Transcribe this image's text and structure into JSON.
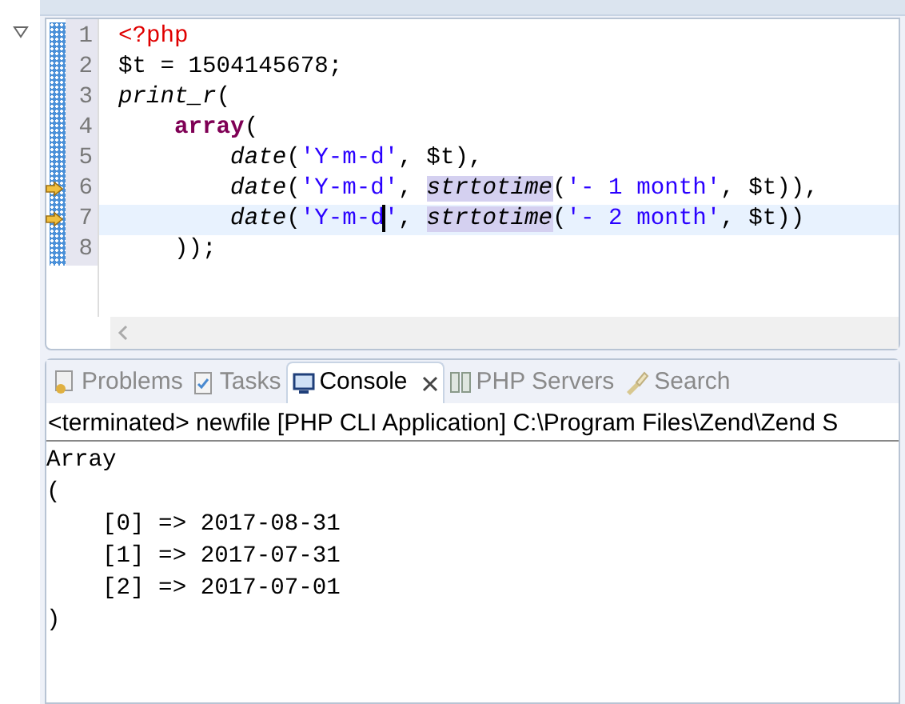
{
  "editor": {
    "lines": [
      {
        "number": "1",
        "current": false,
        "marker": false,
        "tokens": [
          {
            "kind": "tag",
            "text": "<?php"
          }
        ]
      },
      {
        "number": "2",
        "current": false,
        "marker": false,
        "tokens": [
          {
            "kind": "plain",
            "text": "$t = 1504145678;"
          }
        ]
      },
      {
        "number": "3",
        "current": false,
        "marker": false,
        "tokens": [
          {
            "kind": "func",
            "text": "print_r"
          },
          {
            "kind": "plain",
            "text": "("
          }
        ]
      },
      {
        "number": "4",
        "current": false,
        "marker": false,
        "tokens": [
          {
            "kind": "keyword",
            "text": "    array"
          },
          {
            "kind": "plain",
            "text": "("
          }
        ]
      },
      {
        "number": "5",
        "current": false,
        "marker": false,
        "tokens": [
          {
            "kind": "func",
            "text": "        date"
          },
          {
            "kind": "plain",
            "text": "("
          },
          {
            "kind": "string",
            "text": "'Y-m-d'"
          },
          {
            "kind": "plain",
            "text": ", $t),"
          }
        ]
      },
      {
        "number": "6",
        "current": false,
        "marker": true,
        "tokens": [
          {
            "kind": "func",
            "text": "        date"
          },
          {
            "kind": "plain",
            "text": "("
          },
          {
            "kind": "string",
            "text": "'Y-m-d'"
          },
          {
            "kind": "plain",
            "text": ", "
          },
          {
            "kind": "hfunc",
            "text": "strtotime"
          },
          {
            "kind": "plain",
            "text": "("
          },
          {
            "kind": "string",
            "text": "'- 1 month'"
          },
          {
            "kind": "plain",
            "text": ", $t)),"
          }
        ]
      },
      {
        "number": "7",
        "current": true,
        "marker": true,
        "tokens": [
          {
            "kind": "func",
            "text": "        date"
          },
          {
            "kind": "plain",
            "text": "("
          },
          {
            "kind": "string",
            "text": "'Y-m-d"
          },
          {
            "kind": "caret"
          },
          {
            "kind": "string",
            "text": "'"
          },
          {
            "kind": "plain",
            "text": ", "
          },
          {
            "kind": "hfunc",
            "text": "strtotime"
          },
          {
            "kind": "plain",
            "text": "("
          },
          {
            "kind": "string",
            "text": "'- 2 month'"
          },
          {
            "kind": "plain",
            "text": ", $t))"
          }
        ]
      },
      {
        "number": "8",
        "current": false,
        "marker": false,
        "tokens": [
          {
            "kind": "plain",
            "text": "    ));"
          }
        ]
      }
    ]
  },
  "panel": {
    "tabs": [
      {
        "label": "Problems",
        "selected": false,
        "kind": "problems"
      },
      {
        "label": "Tasks",
        "selected": false,
        "kind": "tasks"
      },
      {
        "label": "Console",
        "selected": true,
        "kind": "console"
      },
      {
        "label": "PHP Servers",
        "selected": false,
        "kind": "servers"
      },
      {
        "label": "Search",
        "selected": false,
        "kind": "search"
      }
    ],
    "header": "<terminated> newfile [PHP CLI Application] C:\\Program Files\\Zend\\Zend S",
    "output": [
      "Array",
      "(",
      "    [0] => 2017-08-31",
      "    [1] => 2017-07-31",
      "    [2] => 2017-07-01",
      ")"
    ]
  }
}
